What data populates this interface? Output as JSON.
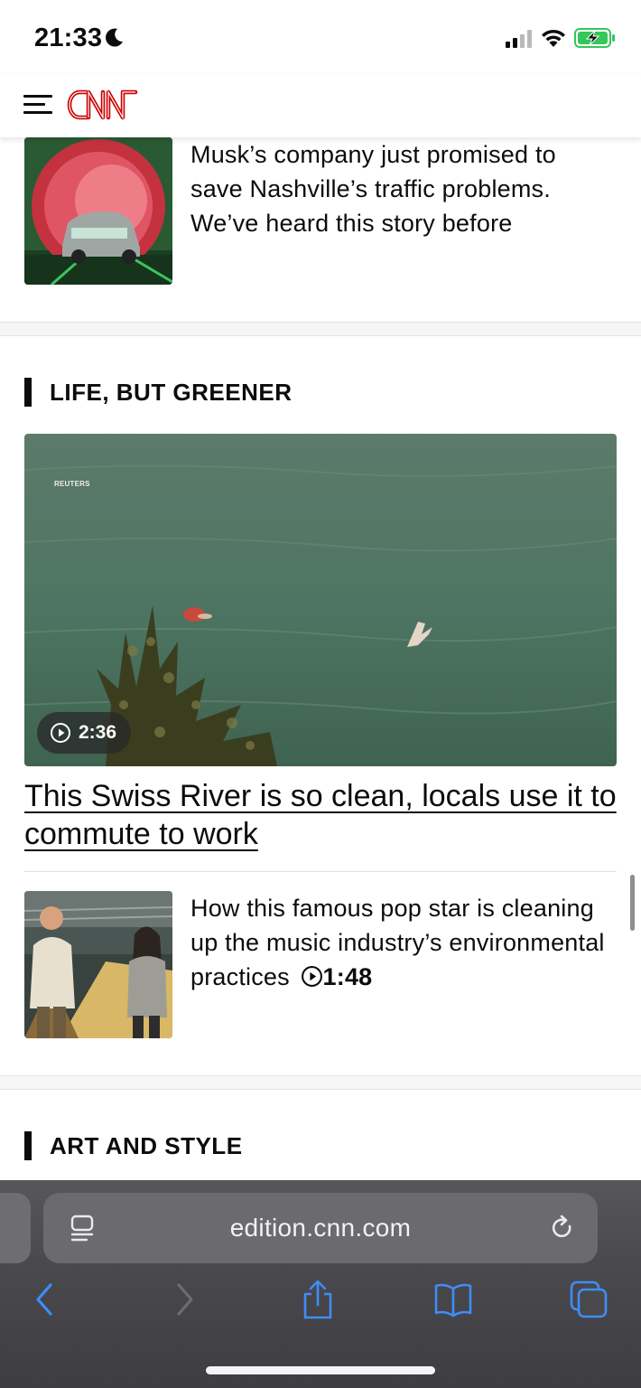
{
  "status_bar": {
    "time": "21:33",
    "icons": [
      "moon-icon",
      "cellular-signal-icon",
      "wifi-icon",
      "battery-charging-icon"
    ],
    "battery_color": "#34c759"
  },
  "header": {
    "menu_icon": "hamburger-menu-icon",
    "logo_text": "CNN",
    "logo_color": "#cc0000"
  },
  "stories": {
    "top_story": {
      "headline": "Musk’s company just promised to save Nashville’s traffic problems. We’ve heard this story before"
    },
    "sections": [
      {
        "title": "LIFE, BUT GREENER",
        "hero": {
          "watermark": "REUTERS",
          "video_duration": "2:36",
          "headline": "This Swiss River is so clean, locals use it to commute to work"
        },
        "items": [
          {
            "headline": "How this famous pop star is cleaning up the music industry’s environmental practices",
            "video_duration": "1:48"
          }
        ]
      },
      {
        "title": "ART AND STYLE"
      }
    ]
  },
  "browser": {
    "url": "edition.cnn.com",
    "toolbar_icons": [
      "back-icon",
      "forward-icon",
      "share-icon",
      "bookmarks-icon",
      "tabs-icon"
    ],
    "accent_color": "#3d8ef7"
  }
}
